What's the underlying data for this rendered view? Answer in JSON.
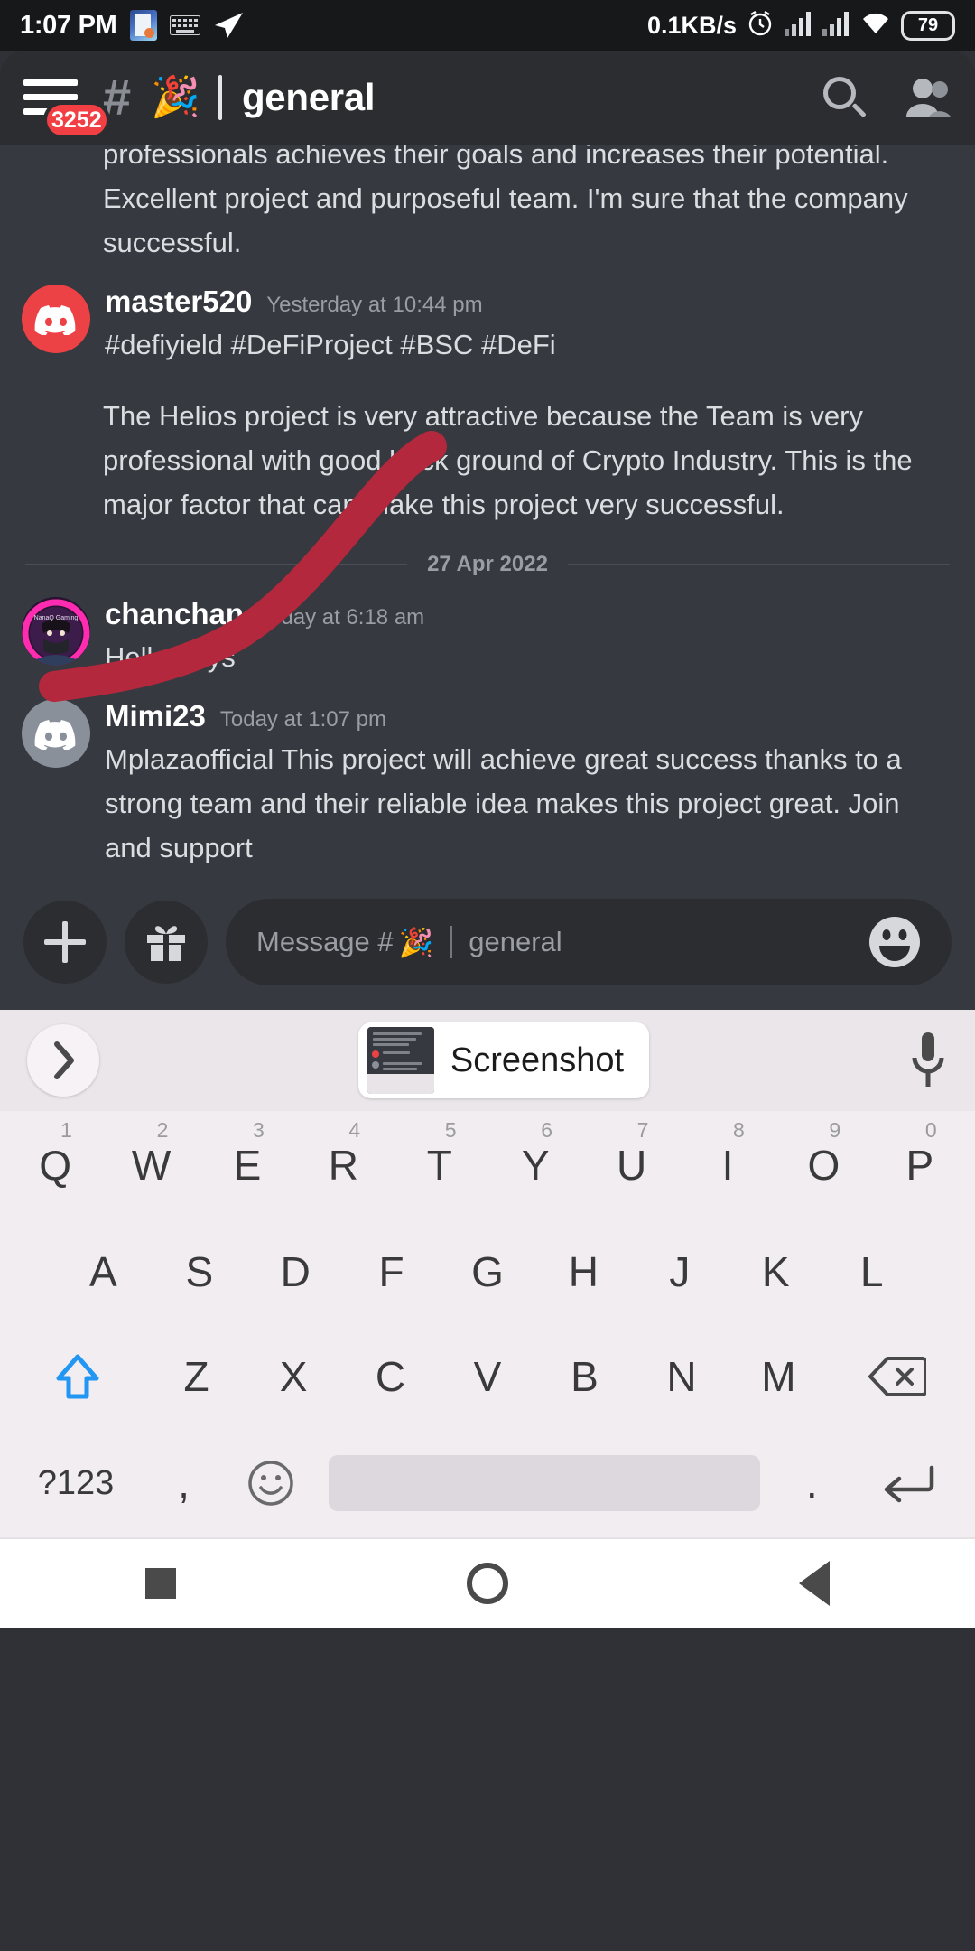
{
  "status_bar": {
    "time": "1:07 PM",
    "data_rate": "0.1KB/s",
    "battery": "79",
    "icons": [
      "gallery-icon",
      "keyboard-icon",
      "telegram-send-icon",
      "alarm-icon",
      "signal-1-icon",
      "signal-2-icon",
      "wifi-icon",
      "battery-icon"
    ]
  },
  "header": {
    "menu_badge": "3252",
    "hash": "#",
    "channel_emoji": "🎉",
    "channel_name": "general",
    "search_label": "Search",
    "members_label": "Members"
  },
  "messages": {
    "clipped_text": "professionals achieves their goals and increases their potential. Excellent project and purposeful team. I'm sure that the company successful.",
    "items": [
      {
        "author": "master520",
        "timestamp": "Yesterday at 10:44 pm",
        "avatar": "discord-logo-red",
        "lines": [
          "#defiyield #DeFiProject #BSC #DeFi",
          "The Helios project is very attractive because the Team is very professional with good back ground of Crypto Industry. This is the major factor that can make this project very successful."
        ]
      },
      {
        "author": "chanchan",
        "timestamp": "Today at 6:18 am",
        "avatar": "nanaq-gaming-avatar",
        "avatar_caption": "NanaQ Gaming",
        "lines": [
          "Hello guys"
        ]
      },
      {
        "author": "Mimi23",
        "timestamp": "Today at 1:07 pm",
        "avatar": "discord-logo-grey",
        "lines": [
          "Mplazaofficial This project will achieve great success thanks to a strong team and their reliable idea makes this project great. Join and support"
        ]
      }
    ],
    "date_divider": "27 Apr 2022"
  },
  "input_bar": {
    "add_label": "+",
    "gift_label": "Gift",
    "placeholder_prefix": "Message #",
    "placeholder_emoji": "🎉",
    "placeholder_channel": "general",
    "emoji_label": "Emoji"
  },
  "keyboard": {
    "suggestion_chip": "Screenshot",
    "expand_label": "Expand",
    "mic_label": "Voice input",
    "row1": [
      {
        "letter": "Q",
        "num": "1"
      },
      {
        "letter": "W",
        "num": "2"
      },
      {
        "letter": "E",
        "num": "3"
      },
      {
        "letter": "R",
        "num": "4"
      },
      {
        "letter": "T",
        "num": "5"
      },
      {
        "letter": "Y",
        "num": "6"
      },
      {
        "letter": "U",
        "num": "7"
      },
      {
        "letter": "I",
        "num": "8"
      },
      {
        "letter": "O",
        "num": "9"
      },
      {
        "letter": "P",
        "num": "0"
      }
    ],
    "row2": [
      "A",
      "S",
      "D",
      "F",
      "G",
      "H",
      "J",
      "K",
      "L"
    ],
    "row3": [
      "Z",
      "X",
      "C",
      "V",
      "B",
      "N",
      "M"
    ],
    "shift_label": "Shift",
    "backspace_label": "Backspace",
    "symbols_label": "?123",
    "comma_label": ",",
    "emoji_key_label": "Emoji",
    "space_label": "Space",
    "period_label": ".",
    "enter_label": "Enter"
  },
  "navbar": {
    "recents_label": "Recents",
    "home_label": "Home",
    "back_label": "Back"
  },
  "colors": {
    "discord_bg": "#36393f",
    "header_bg": "#2b2d31",
    "accent_red": "#ed4245",
    "badge_red": "#f23f43",
    "annotation_red": "#b3283c",
    "keyboard_bg": "#f1edf0"
  }
}
